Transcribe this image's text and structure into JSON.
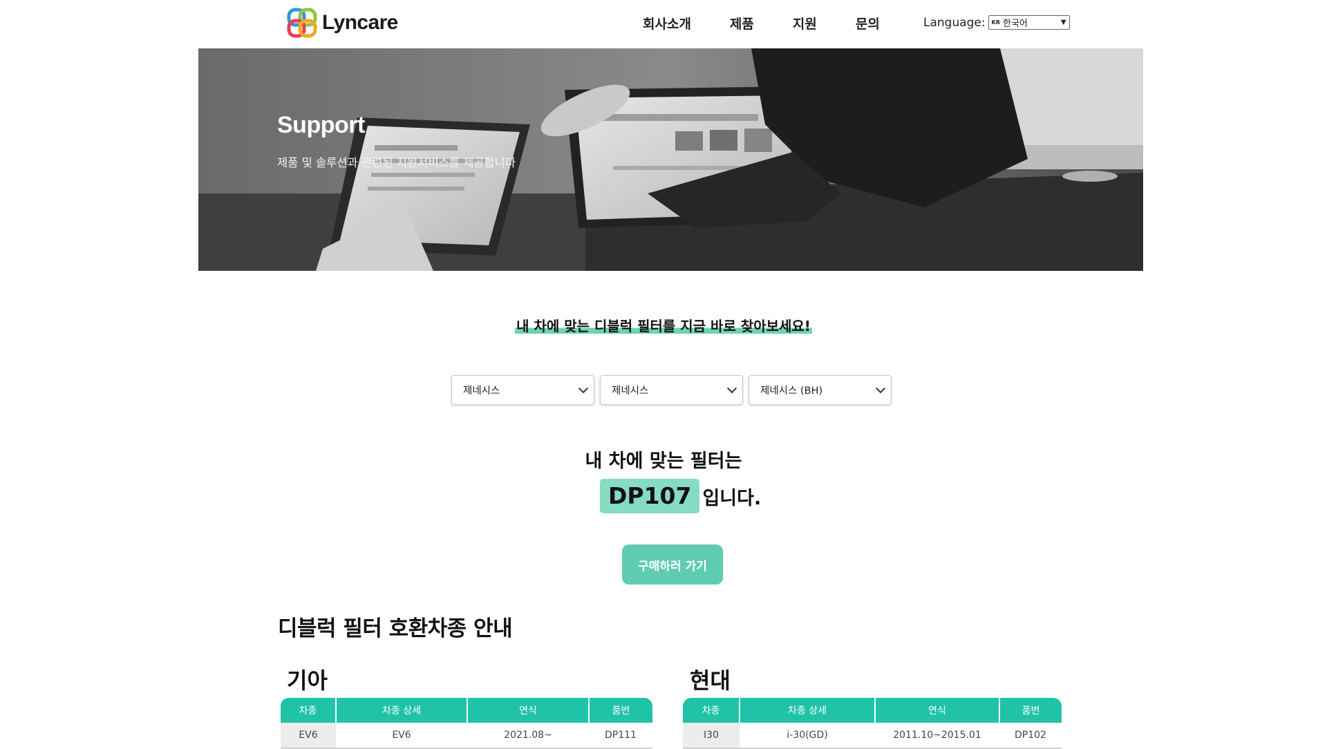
{
  "header": {
    "logo_text": "Lyncare",
    "nav": [
      "회사소개",
      "제품",
      "지원",
      "문의"
    ],
    "language_label": "Language:",
    "language_flag": "KR",
    "language_value": "한국어"
  },
  "hero": {
    "title": "Support",
    "subtitle": "제품 및 솔루션과 관련된 지원서비스를 제공합니다"
  },
  "finder": {
    "heading": "내 차에 맞는 디블럭 필터를 지금 바로 찾아보세요!",
    "selects": [
      "제네시스",
      "제네시스",
      "제네시스 (BH)"
    ],
    "result_prefix": "내 차에 맞는 필터는",
    "result_code": "DP107",
    "result_suffix": "입니다.",
    "buy_button": "구매하러 가기"
  },
  "compat": {
    "heading": "디블럭 필터 호환차종 안내",
    "tables": [
      {
        "brand": "기아",
        "columns": [
          "차종",
          "차종 상세",
          "연식",
          "품번"
        ],
        "rows": [
          [
            "EV6",
            "EV6",
            "2021.08~",
            "DP111"
          ]
        ]
      },
      {
        "brand": "현대",
        "columns": [
          "차종",
          "차종 상세",
          "연식",
          "품번"
        ],
        "rows": [
          [
            "I30",
            "i-30(GD)",
            "2011.10~2015.01",
            "DP102"
          ]
        ]
      }
    ]
  },
  "colors": {
    "accent": "#20c3a7",
    "button": "#5fccb1",
    "highlight": "#86dcc3"
  }
}
